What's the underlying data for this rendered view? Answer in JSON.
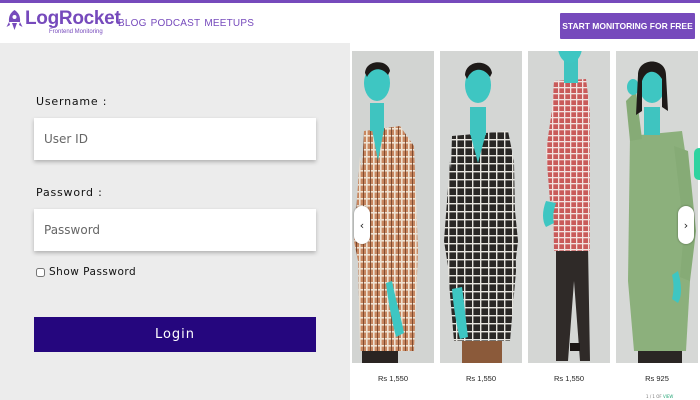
{
  "brand": {
    "name": "LogRocket",
    "tagline": "Frontend Monitoring",
    "accent": "#764abc"
  },
  "nav": {
    "links": [
      "BLOG",
      "PODCAST",
      "MEETUPS"
    ],
    "cta_label": "START MONITORING FOR FREE"
  },
  "login_form": {
    "username_label": "Username :",
    "username_placeholder": "User ID",
    "password_label": "Password :",
    "password_placeholder": "Password",
    "show_password_label": "Show Password",
    "show_password_checked": false,
    "login_button": "Login",
    "button_color": "#25067e"
  },
  "products": [
    {
      "price": "Rs 1,550",
      "shirt": "plaid-orange",
      "pants": "dark"
    },
    {
      "price": "Rs 1,550",
      "shirt": "plaid-black",
      "pants": "brown"
    },
    {
      "price": "Rs 1,550",
      "shirt": "plaid-red",
      "pants": "dark"
    },
    {
      "price": "Rs 925",
      "shirt": "solid-green",
      "pants": "dark"
    }
  ],
  "carousel": {
    "prev_icon": "chevron-left-icon",
    "next_icon": "chevron-right-icon",
    "footer_text": "1 / 1 OF",
    "footer_link": "VIEW"
  }
}
